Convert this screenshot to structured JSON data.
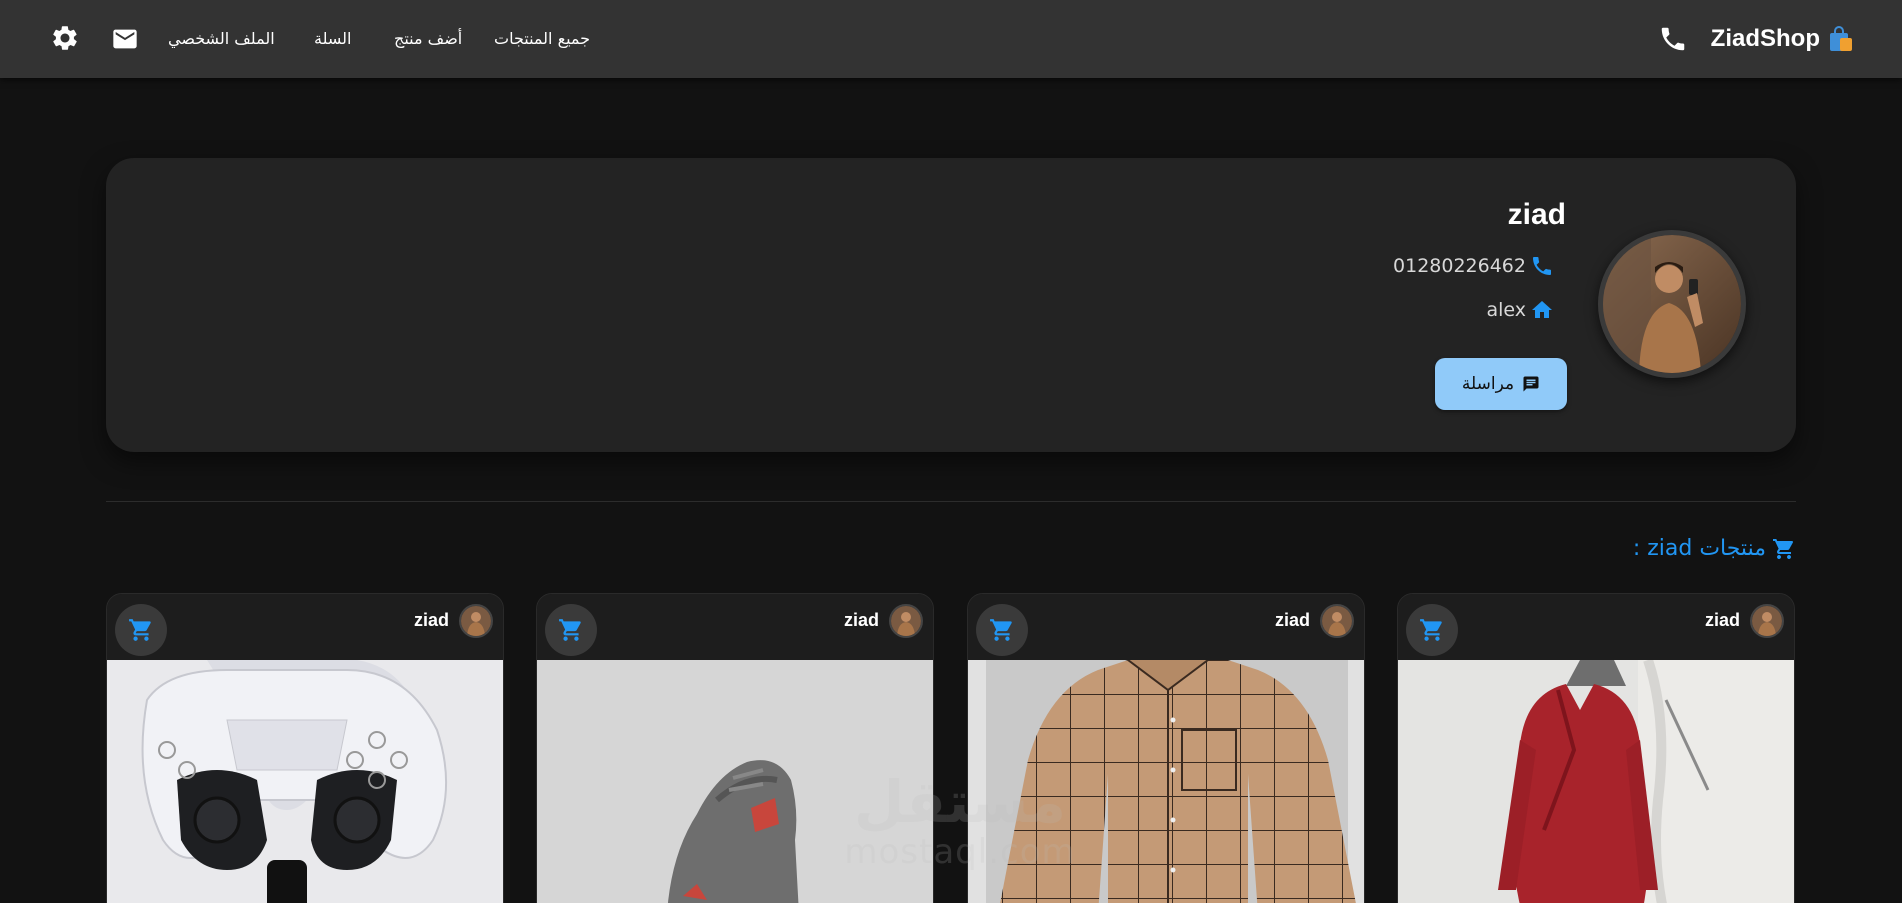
{
  "header": {
    "brand": "ZiadShop",
    "nav": {
      "all_products": "جميع المنتجات",
      "add_product": "أضف منتج",
      "cart": "السلة",
      "profile": "الملف الشخصي"
    },
    "icons": [
      "shopping-bag-icon",
      "phone-icon",
      "mail-icon",
      "gear-icon"
    ]
  },
  "profile": {
    "name": "ziad",
    "phone": "01280226462",
    "city": "alex",
    "message_button": "مراسلة"
  },
  "section": {
    "title": "منتجات ziad :"
  },
  "products": [
    {
      "owner": "ziad",
      "image": "red-wrap-dress"
    },
    {
      "owner": "ziad",
      "image": "plaid-shirt"
    },
    {
      "owner": "ziad",
      "image": "grey-sneaker"
    },
    {
      "owner": "ziad",
      "image": "game-controllers"
    }
  ],
  "watermark": {
    "arabic": "مستقل",
    "latin": "mostaql.com"
  },
  "colors": {
    "background": "#121212",
    "header": "#333333",
    "card": "#232323",
    "accent": "#2196f3",
    "button": "#90caf9"
  }
}
